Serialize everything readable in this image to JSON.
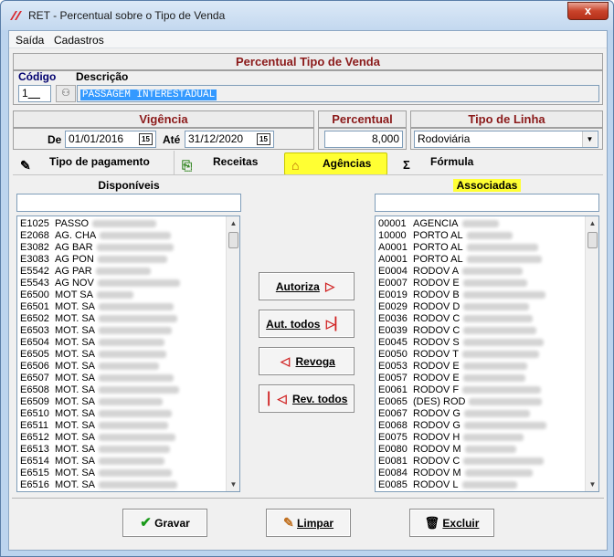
{
  "window": {
    "title": "RET - Percentual sobre o Tipo de Venda",
    "close_label": "x"
  },
  "menu": {
    "items": [
      "Saída",
      "Cadastros"
    ]
  },
  "tipo_venda": {
    "header": "Percentual Tipo de Venda",
    "codigo_label": "Código",
    "descricao_label": "Descrição",
    "codigo_value": "1",
    "descricao_value": "PASSAGEM INTERESTADUAL"
  },
  "vigencia": {
    "header": "Vigência",
    "de_label": "De",
    "de_value": "01/01/2016",
    "ate_label": "Até",
    "ate_value": "31/12/2020",
    "calendar_glyph": "15"
  },
  "percentual": {
    "header": "Percentual",
    "value": "8,000"
  },
  "tipo_linha": {
    "header": "Tipo de Linha",
    "value": "Rodoviária"
  },
  "tabs": [
    {
      "label": "Tipo de pagamento",
      "icon": "pencil-icon",
      "active": false
    },
    {
      "label": "Receitas",
      "icon": "document-arrow-icon",
      "active": false
    },
    {
      "label": "Agências",
      "icon": "house-icon",
      "active": true
    },
    {
      "label": "Fórmula",
      "icon": "sigma-icon",
      "active": false
    }
  ],
  "disponiveis": {
    "header": "Disponíveis",
    "filter_value": "",
    "items": [
      {
        "code": "E1025",
        "text": "PASSO"
      },
      {
        "code": "E2068",
        "text": "AG. CHA"
      },
      {
        "code": "E3082",
        "text": "AG BAR"
      },
      {
        "code": "E3083",
        "text": "AG PON"
      },
      {
        "code": "E5542",
        "text": "AG PAR"
      },
      {
        "code": "E5543",
        "text": "AG NOV"
      },
      {
        "code": "E6500",
        "text": "MOT SA"
      },
      {
        "code": "E6501",
        "text": "MOT. SA"
      },
      {
        "code": "E6502",
        "text": "MOT. SA"
      },
      {
        "code": "E6503",
        "text": "MOT. SA"
      },
      {
        "code": "E6504",
        "text": "MOT. SA"
      },
      {
        "code": "E6505",
        "text": "MOT. SA"
      },
      {
        "code": "E6506",
        "text": "MOT. SA"
      },
      {
        "code": "E6507",
        "text": "MOT. SA"
      },
      {
        "code": "E6508",
        "text": "MOT. SA"
      },
      {
        "code": "E6509",
        "text": "MOT. SA"
      },
      {
        "code": "E6510",
        "text": "MOT. SA"
      },
      {
        "code": "E6511",
        "text": "MOT. SA"
      },
      {
        "code": "E6512",
        "text": "MOT. SA"
      },
      {
        "code": "E6513",
        "text": "MOT. SA"
      },
      {
        "code": "E6514",
        "text": "MOT. SA"
      },
      {
        "code": "E6515",
        "text": "MOT. SA"
      },
      {
        "code": "E6516",
        "text": "MOT. SA"
      }
    ]
  },
  "associadas": {
    "header": "Associadas",
    "filter_value": "",
    "items": [
      {
        "code": "00001",
        "text": "AGENCIA"
      },
      {
        "code": "10000",
        "text": "PORTO AL"
      },
      {
        "code": "A0001",
        "text": "PORTO AL"
      },
      {
        "code": "A0001",
        "text": "PORTO AL"
      },
      {
        "code": "E0004",
        "text": "RODOV A"
      },
      {
        "code": "E0007",
        "text": "RODOV E"
      },
      {
        "code": "E0019",
        "text": "RODOV B"
      },
      {
        "code": "E0029",
        "text": "RODOV D"
      },
      {
        "code": "E0036",
        "text": "RODOV C"
      },
      {
        "code": "E0039",
        "text": "RODOV C"
      },
      {
        "code": "E0045",
        "text": "RODOV S"
      },
      {
        "code": "E0050",
        "text": "RODOV T"
      },
      {
        "code": "E0053",
        "text": "RODOV E"
      },
      {
        "code": "E0057",
        "text": "RODOV E"
      },
      {
        "code": "E0061",
        "text": "RODOV F"
      },
      {
        "code": "E0065",
        "text": "(DES) ROD"
      },
      {
        "code": "E0067",
        "text": "RODOV G"
      },
      {
        "code": "E0068",
        "text": "RODOV G"
      },
      {
        "code": "E0075",
        "text": "RODOV H"
      },
      {
        "code": "E0080",
        "text": "RODOV M"
      },
      {
        "code": "E0081",
        "text": "RODOV C"
      },
      {
        "code": "E0084",
        "text": "RODOV M"
      },
      {
        "code": "E0085",
        "text": "RODOV L"
      }
    ]
  },
  "actions": {
    "autoriza": "Autoriza",
    "aut_todos": "Aut. todos",
    "revoga": "Revoga",
    "rev_todos": "Rev. todos"
  },
  "footer": {
    "gravar": "Gravar",
    "limpar": "Limpar",
    "excluir": "Excluir"
  },
  "colors": {
    "header_text": "#8b1a1a",
    "navy_label": "#00006e",
    "active_tab": "#ffff33",
    "selection": "#3399ff",
    "arrow_red": "#d02020"
  }
}
